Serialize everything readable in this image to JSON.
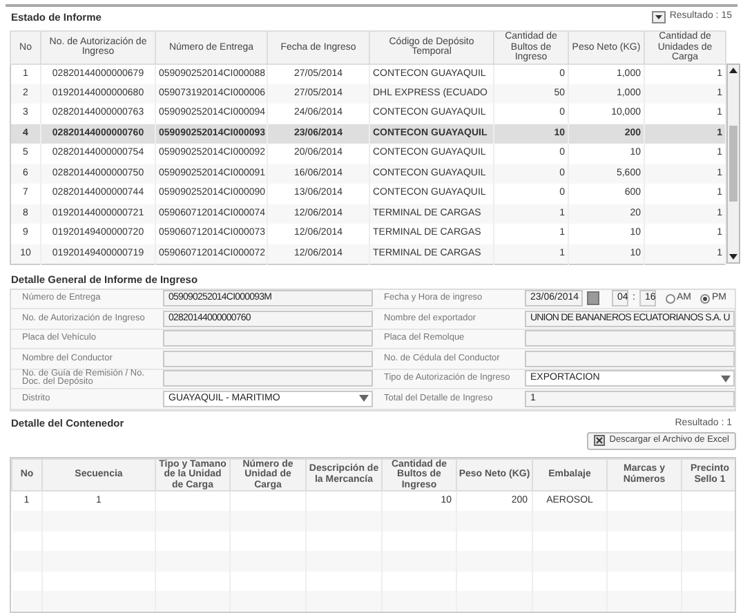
{
  "report_status": {
    "title": "Estado de Informe",
    "result": "Resultado : 15",
    "columns": [
      "No",
      "No. de Autorización de Ingreso",
      "Número de Entrega",
      "Fecha de Ingreso",
      "Código de Depósito Temporal",
      "Cantidad de Bultos de Ingreso",
      "Peso Neto (KG)",
      "Cantidad de Unidades de Carga"
    ],
    "rows": [
      {
        "cells": [
          "1",
          "02820144000000679",
          "059090252014CI000088",
          "27/05/2014",
          "CONTECON GUAYAQUIL",
          "0",
          "1,000",
          "1"
        ],
        "selected": false
      },
      {
        "cells": [
          "2",
          "01920144000000680",
          "059073192014CI000006",
          "27/05/2014",
          "DHL EXPRESS (ECUADO",
          "50",
          "1,000",
          "1"
        ],
        "selected": false
      },
      {
        "cells": [
          "3",
          "02820144000000763",
          "059090252014CI000094",
          "24/06/2014",
          "CONTECON GUAYAQUIL",
          "0",
          "10,000",
          "1"
        ],
        "selected": false
      },
      {
        "cells": [
          "4",
          "02820144000000760",
          "059090252014CI000093",
          "23/06/2014",
          "CONTECON GUAYAQUIL",
          "10",
          "200",
          "1"
        ],
        "selected": true
      },
      {
        "cells": [
          "5",
          "02820144000000754",
          "059090252014CI000092",
          "20/06/2014",
          "CONTECON GUAYAQUIL",
          "0",
          "10",
          "1"
        ],
        "selected": false
      },
      {
        "cells": [
          "6",
          "02820144000000750",
          "059090252014CI000091",
          "16/06/2014",
          "CONTECON GUAYAQUIL",
          "0",
          "5,600",
          "1"
        ],
        "selected": false
      },
      {
        "cells": [
          "7",
          "02820144000000744",
          "059090252014CI000090",
          "13/06/2014",
          "CONTECON GUAYAQUIL",
          "0",
          "600",
          "1"
        ],
        "selected": false
      },
      {
        "cells": [
          "8",
          "01920144000000721",
          "059060712014CI000074",
          "12/06/2014",
          "TERMINAL DE CARGAS",
          "1",
          "20",
          "1"
        ],
        "selected": false
      },
      {
        "cells": [
          "9",
          "01920149400000720",
          "059060712014CI000073",
          "12/06/2014",
          "TERMINAL DE CARGAS",
          "1",
          "10",
          "1"
        ],
        "selected": false
      },
      {
        "cells": [
          "10",
          "01920149400000719",
          "059060712014CI000072",
          "12/06/2014",
          "TERMINAL DE CARGAS",
          "1",
          "10",
          "1"
        ],
        "selected": false
      }
    ]
  },
  "general_detail": {
    "title": "Detalle General de Informe de Ingreso",
    "fields": [
      {
        "label": "Número de Entrega",
        "kind": "text",
        "value": "059090252014CI000093M"
      },
      {
        "label": "Fecha y Hora de ingreso",
        "kind": "datetime",
        "value": "23/06/2014",
        "hour": "04",
        "separator": ":",
        "minute": "16",
        "options": [
          {
            "label": "AM",
            "selected": false
          },
          {
            "label": "PM",
            "selected": true
          }
        ]
      },
      {
        "label": "No. de Autorización de Ingreso",
        "kind": "text",
        "value": "02820144000000760"
      },
      {
        "label": "Nombre del exportador",
        "kind": "text",
        "value": "UNION DE BANANEROS ECUATORIANOS S.A. U"
      },
      {
        "label": "Placa del Vehículo",
        "kind": "text"
      },
      {
        "label": "Placa del Remolque",
        "kind": "text"
      },
      {
        "label": "Nombre del Conductor",
        "kind": "text"
      },
      {
        "label": "No. de Cédula del Conductor",
        "kind": "text"
      },
      {
        "label": "No. de Guía de Remisión / No. Doc. del Depósito",
        "kind": "text"
      },
      {
        "label": "Tipo de Autorización de Ingreso",
        "kind": "select",
        "value": "EXPORTACION"
      },
      {
        "label": "Distrito",
        "kind": "select",
        "value": "GUAYAQUIL - MARITIMO"
      },
      {
        "label": "Total del Detalle de Ingreso",
        "kind": "text",
        "value": "1"
      }
    ]
  },
  "container_detail": {
    "title": "Detalle del Contenedor",
    "result": "Resultado : 1",
    "export_button": "Descargar el Archivo de Excel",
    "columns": [
      "No",
      "Secuencia",
      "Tipo y Tamano de la Unidad de Carga",
      "Número de Unidad de Carga",
      "Descripción de la Mercancía",
      "Cantidad de Bultos de Ingreso",
      "Peso Neto (KG)",
      "Embalaje",
      "Marcas y Números",
      "Precinto Sello 1"
    ],
    "rows": [
      {
        "cells": [
          "1",
          "1",
          "",
          "",
          "",
          "10",
          "200",
          "AEROSOL",
          "",
          ""
        ]
      }
    ]
  }
}
